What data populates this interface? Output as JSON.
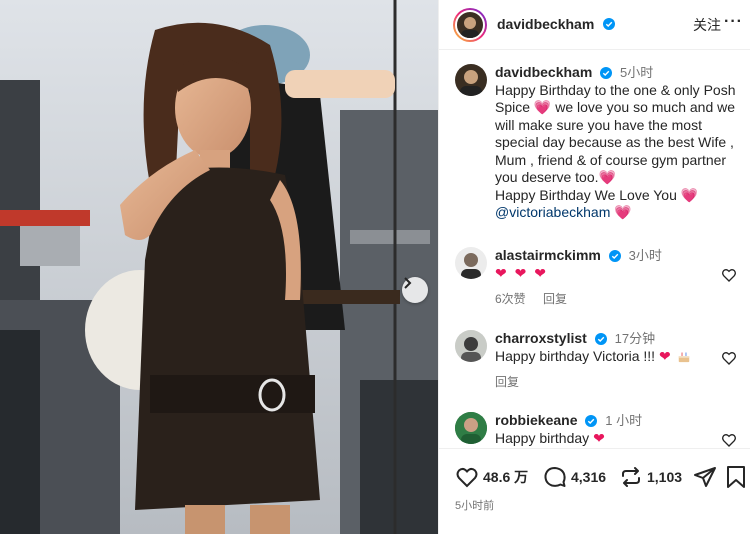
{
  "header": {
    "username": "davidbeckham",
    "follow_label": "关注",
    "more_label": "···"
  },
  "post": {
    "username": "davidbeckham",
    "time": "5小时",
    "caption_before": "Happy Birthday to the one & only Posh Spice ",
    "caption_mid1": " we love you so much and we will make sure you have the most special day because as the best Wife , Mum , friend & of course gym partner you deserve too.",
    "caption_mid2": "Happy Birthday We Love You ",
    "mention": "@victoriabeckham",
    "emoji_heart": "💗"
  },
  "comments": [
    {
      "username": "alastairmckimm",
      "time": "3小时",
      "text": "❤ ❤ ❤",
      "likes": "6次赞",
      "reply": "回复"
    },
    {
      "username": "charroxstylist",
      "time": "17分钟",
      "text": "Happy birthday Victoria !!! ",
      "emoji": "❤",
      "reply": "回复"
    },
    {
      "username": "robbiekeane",
      "time": "1 小时",
      "text": "Happy birthday ",
      "emoji": "❤"
    }
  ],
  "actions": {
    "likes": "48.6 万",
    "comments": "4,316",
    "reposts": "1,103",
    "posted": "5小时前"
  },
  "colors": {
    "verified": "#0095f6",
    "heart_red": "#e8175d",
    "link": "#00376b",
    "muted": "#737373"
  },
  "icons": [
    "carousel-next-icon",
    "verified-icon",
    "heart-outline-icon",
    "comment-icon",
    "repost-icon",
    "share-icon",
    "save-icon"
  ]
}
